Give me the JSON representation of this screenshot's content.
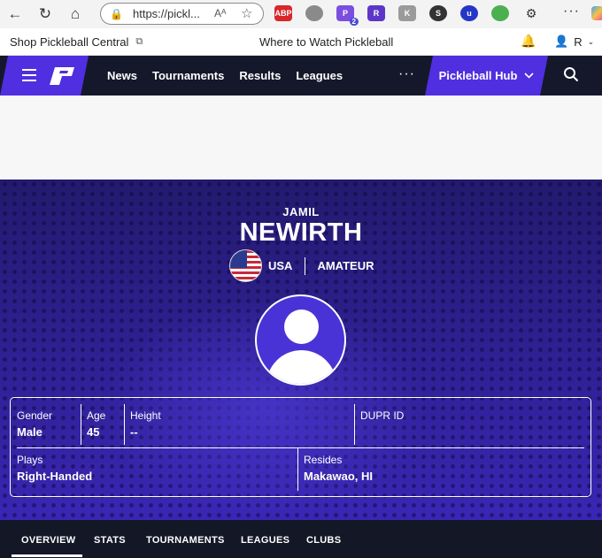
{
  "browser": {
    "url": "https://pickl...",
    "reader_icon": "Aᴬ",
    "extensions": [
      {
        "label": "ABP",
        "color": "#d8262a"
      },
      {
        "label": "",
        "color": "#7a7a7a"
      },
      {
        "label": "P",
        "color": "#7a4fe0",
        "badge": "2"
      },
      {
        "label": "R",
        "color": "#5d36c9"
      },
      {
        "label": "K",
        "color": "#9a9a9a"
      },
      {
        "label": "S",
        "color": "#333333"
      },
      {
        "label": "u",
        "color": "#2436c8"
      },
      {
        "label": "",
        "color": "#4caf50"
      }
    ]
  },
  "utility": {
    "shop_label": "Shop Pickleball Central",
    "watch_label": "Where to Watch Pickleball",
    "user_initial": "R"
  },
  "nav": {
    "links": [
      "News",
      "Tournaments",
      "Results",
      "Leagues"
    ],
    "more": "···",
    "hub_label": "Pickleball Hub"
  },
  "player": {
    "first_name": "JAMIL",
    "last_name": "NEWIRTH",
    "country": "USA",
    "level": "AMATEUR",
    "gender_label": "Gender",
    "gender": "Male",
    "age_label": "Age",
    "age": "45",
    "height_label": "Height",
    "height": "--",
    "dupr_label": "DUPR ID",
    "dupr": "",
    "plays_label": "Plays",
    "plays": "Right-Handed",
    "resides_label": "Resides",
    "resides": "Makawao, HI"
  },
  "tabs": [
    "OVERVIEW",
    "STATS",
    "TOURNAMENTS",
    "LEAGUES",
    "CLUBS"
  ],
  "colors": {
    "brand_purple": "#4f2fe0",
    "nav_dark": "#15182a"
  }
}
